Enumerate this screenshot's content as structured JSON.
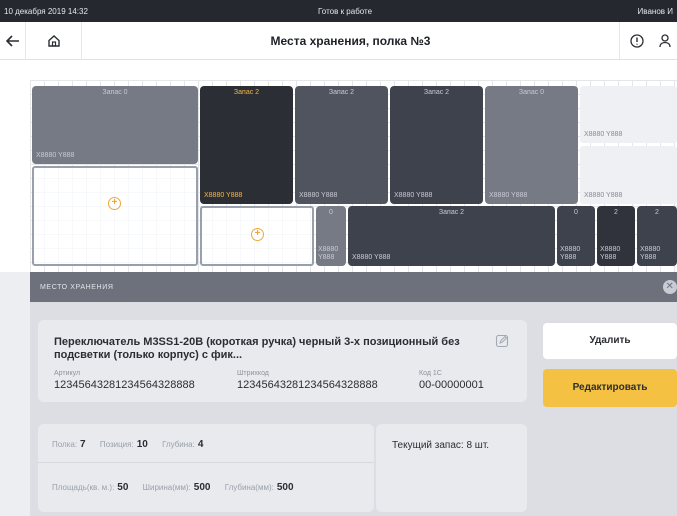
{
  "status_bar": {
    "datetime": "10 декабря 2019 14:32",
    "status": "Готов к работе",
    "user": "Иванов И"
  },
  "nav": {
    "title": "Места хранения, полка №3",
    "back_icon": "arrow-left-icon",
    "home_icon": "home-icon",
    "info_icon": "info-circle-icon",
    "user_icon": "user-icon"
  },
  "shelf": {
    "cells": [
      {
        "stock": "Запас 0",
        "code": "X8880 Y888"
      },
      {
        "stock": "Запас 2",
        "code": "X8880 Y888"
      },
      {
        "stock": "Запас 2",
        "code": "X8880 Y888"
      },
      {
        "stock": "Запас 2",
        "code": "X8880 Y888"
      },
      {
        "stock": "Запас 0",
        "code": "X8880 Y888"
      },
      {
        "stock": "",
        "code": "X8880 Y888"
      },
      {
        "stock": "",
        "code": "X8880 Y888"
      },
      {
        "stock": "0",
        "code": "X8880 Y888"
      },
      {
        "stock": "Запас 2",
        "code": "X8880 Y888"
      },
      {
        "stock": "0",
        "code": "X8880 Y888"
      },
      {
        "stock": "2",
        "code": "X8880 Y888"
      },
      {
        "stock": "2",
        "code": "X8880 Y888"
      }
    ],
    "add_symbol": "+"
  },
  "panel": {
    "header": "МЕСТО ХРАНЕНИЯ",
    "close_symbol": "✕",
    "product_name": "Переключатель M3SS1-20B (короткая ручка) черный 3-х позиционный без подсветки (только корпус) с фик...",
    "article_label": "Артикул",
    "article_value": "12345643281234564328888",
    "barcode_label": "Штрихкод",
    "barcode_value": "12345643281234564328888",
    "code1c_label": "Код 1С",
    "code1c_value": "00-00000001",
    "shelf_label": "Полка:",
    "shelf_value": "7",
    "position_label": "Позиция:",
    "position_value": "10",
    "depth_label": "Глубина:",
    "depth_value": "4",
    "area_label": "Площадь(кв. м.):",
    "area_value": "50",
    "width_label": "Ширина(мм):",
    "width_value": "500",
    "depth_mm_label": "Глубина(мм):",
    "depth_mm_value": "500",
    "stock_text": "Текущий запас: 8 шт.",
    "delete_label": "Удалить",
    "edit_label": "Редактировать"
  },
  "colors": {
    "accent": "#f5c143",
    "dark_cell": "#50545f",
    "highlight_text": "#f3b84a"
  }
}
